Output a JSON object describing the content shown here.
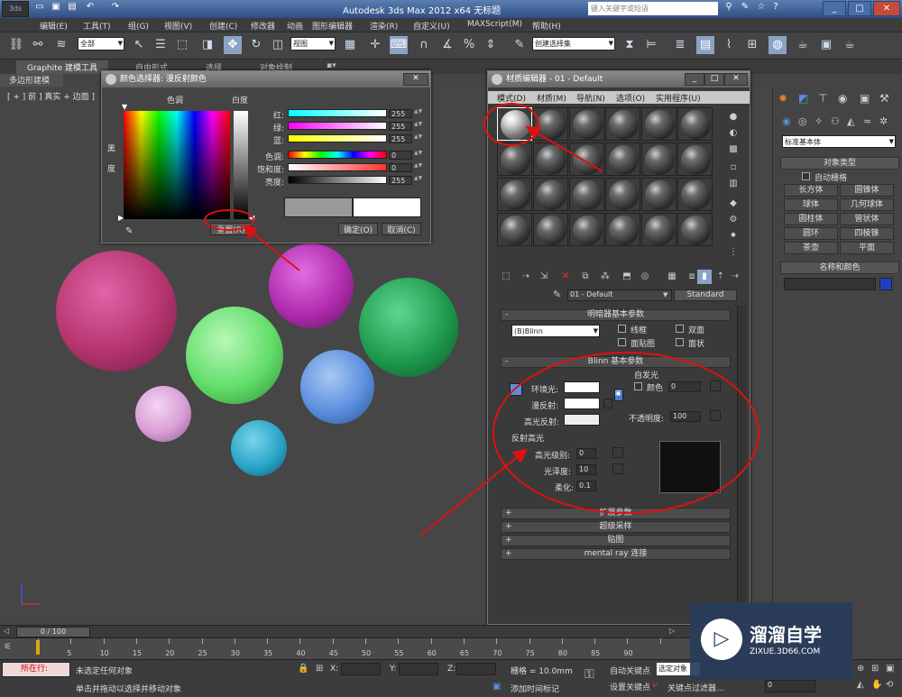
{
  "app": {
    "title": "Autodesk 3ds Max  2012 x64      无标题",
    "search_placeholder": "键入关键字或短语"
  },
  "menubar": [
    "编辑(E)",
    "工具(T)",
    "组(G)",
    "视图(V)",
    "创建(C)",
    "修改器",
    "动画",
    "图形编辑器",
    "渲染(R)",
    "自定义(U)",
    "MAXScript(M)",
    "帮助(H)"
  ],
  "toolbar": {
    "selection_filter": "全部",
    "reference_coord": "视图",
    "named_selection": "创建选择集"
  },
  "ribbon": {
    "tabs": [
      "Graphite 建模工具",
      "自由形式",
      "选择",
      "对象绘制"
    ],
    "subtab": "多边形建模"
  },
  "viewport": {
    "label": "[ + ] 前 ] 真实 + 边面 ]"
  },
  "spheres_colors": {
    "magenta": "#b5356e",
    "purple": "#b02cae",
    "green_light": "#62de6a",
    "green_dark": "#1f9a4e",
    "blue": "#5b8fde",
    "pink": "#d99ed6",
    "cyan": "#2aa6c8"
  },
  "color_picker": {
    "title": "颜色选择器: 漫反射颜色",
    "hue_label": "色调",
    "whiteness_label": "白度",
    "blackness_label": "黑度",
    "channels": [
      {
        "label": "红:",
        "value": "255"
      },
      {
        "label": "绿:",
        "value": "255"
      },
      {
        "label": "蓝:",
        "value": "255"
      },
      {
        "label": "色调:",
        "value": "0"
      },
      {
        "label": "饱和度:",
        "value": "0"
      },
      {
        "label": "亮度:",
        "value": "255"
      }
    ],
    "reset_button": "重置(R)",
    "ok_button": "确定(O)",
    "cancel_button": "取消(C)"
  },
  "material_editor": {
    "title": "材质编辑器 - 01 - Default",
    "menu": [
      "模式(D)",
      "材质(M)",
      "导航(N)",
      "选项(O)",
      "实用程序(U)"
    ],
    "material_name": "01 - Default",
    "material_type": "Standard",
    "shader_rollout": "明暗器基本参数",
    "shader": "(B)Blinn",
    "shader_options": [
      "线框",
      "双面",
      "面贴图",
      "面状"
    ],
    "blinn_rollout": "Blinn 基本参数",
    "self_illum_group": "自发光",
    "self_illum_color_label": "颜色",
    "self_illum_value": "0",
    "ambient_label": "环境光:",
    "diffuse_label": "漫反射:",
    "specular_label": "高光反射:",
    "opacity_label": "不透明度:",
    "opacity_value": "100",
    "specular_group": "反射高光",
    "spec_level_label": "高光级别:",
    "spec_level_value": "0",
    "glossiness_label": "光泽度:",
    "glossiness_value": "10",
    "soften_label": "柔化:",
    "soften_value": "0.1",
    "rollouts": [
      "扩展参数",
      "超级采样",
      "贴图",
      "mental ray 连接"
    ]
  },
  "command_panel": {
    "dropdown": "标准基本体",
    "object_type_header": "对象类型",
    "autogrid_label": "自动栅格",
    "buttons": [
      "长方体",
      "圆锥体",
      "球体",
      "几何球体",
      "圆柱体",
      "管状体",
      "圆环",
      "四棱锥",
      "茶壶",
      "平面"
    ],
    "name_color_header": "名称和颜色",
    "object_color": "#2040c0"
  },
  "timeline": {
    "slider": "0 / 100",
    "ticks": [
      "5",
      "10",
      "15",
      "20",
      "25",
      "30",
      "35",
      "40",
      "45",
      "50",
      "55",
      "60",
      "65",
      "70",
      "75",
      "80",
      "85",
      "90"
    ]
  },
  "status": {
    "maxscript_label": "所在行:",
    "selection_status": "未选定任何对象",
    "prompt": "单击并拖动以选择并移动对象",
    "x_label": "X:",
    "y_label": "Y:",
    "z_label": "Z:",
    "grid": "栅格 = 10.0mm",
    "add_time_tag": "添加时间标记",
    "auto_key": "自动关键点",
    "set_key": "设置关键点",
    "selected_object": "选定对象",
    "key_filters": "关键点过滤器...",
    "frame": "0"
  },
  "watermark": {
    "brand": "溜溜自学",
    "url": "ZIXUE.3D66.COM"
  }
}
